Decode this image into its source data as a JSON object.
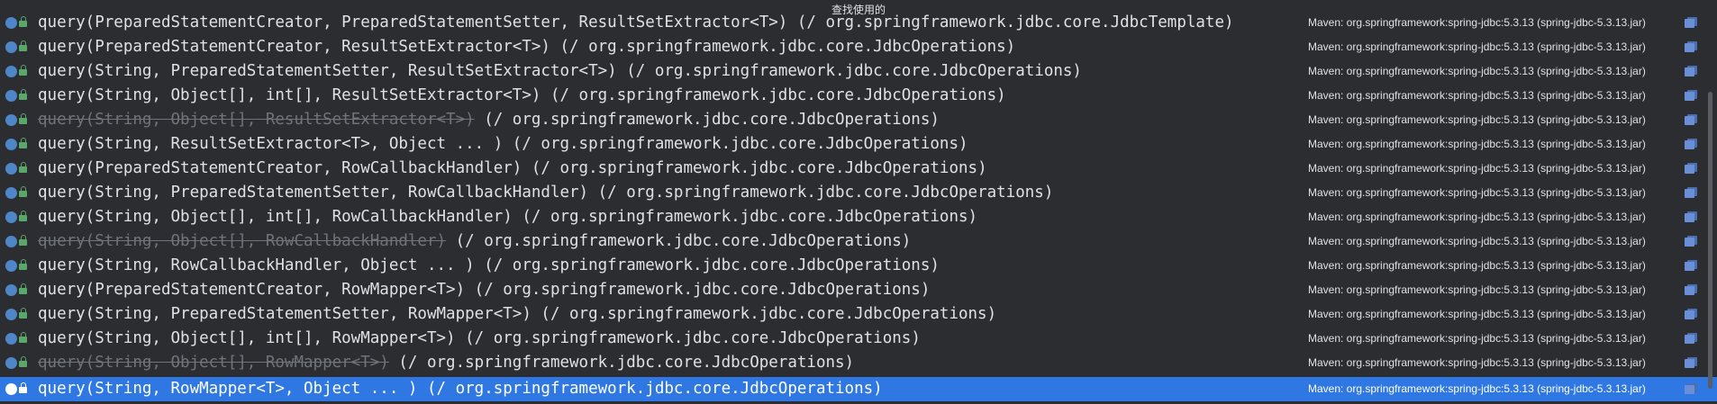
{
  "popup": {
    "title": "查找使用的"
  },
  "results": [
    {
      "parts": [
        {
          "t": "query(PreparedStatementCreator, PreparedStatementSetter, ResultSetExtractor<T>)",
          "d": false
        },
        {
          "t": " (/ org.springframework.jdbc.core.JdbcTemplate)",
          "d": false
        }
      ],
      "location": "Maven: org.springframework:spring-jdbc:5.3.13 (spring-jdbc-5.3.13.jar)",
      "selected": false
    },
    {
      "parts": [
        {
          "t": "query(PreparedStatementCreator, ResultSetExtractor<T>)",
          "d": false
        },
        {
          "t": " (/ org.springframework.jdbc.core.JdbcOperations)",
          "d": false
        }
      ],
      "location": "Maven: org.springframework:spring-jdbc:5.3.13 (spring-jdbc-5.3.13.jar)",
      "selected": false
    },
    {
      "parts": [
        {
          "t": "query(String, PreparedStatementSetter, ResultSetExtractor<T>)",
          "d": false
        },
        {
          "t": " (/ org.springframework.jdbc.core.JdbcOperations)",
          "d": false
        }
      ],
      "location": "Maven: org.springframework:spring-jdbc:5.3.13 (spring-jdbc-5.3.13.jar)",
      "selected": false
    },
    {
      "parts": [
        {
          "t": "query(String, Object[], int[], ResultSetExtractor<T>)",
          "d": false
        },
        {
          "t": " (/ org.springframework.jdbc.core.JdbcOperations)",
          "d": false
        }
      ],
      "location": "Maven: org.springframework:spring-jdbc:5.3.13 (spring-jdbc-5.3.13.jar)",
      "selected": false
    },
    {
      "parts": [
        {
          "t": "query(String, Object[], ResultSetExtractor<T>)",
          "d": true
        },
        {
          "t": " (/ org.springframework.jdbc.core.JdbcOperations)",
          "d": false
        }
      ],
      "location": "Maven: org.springframework:spring-jdbc:5.3.13 (spring-jdbc-5.3.13.jar)",
      "selected": false
    },
    {
      "parts": [
        {
          "t": "query(String, ResultSetExtractor<T>, Object ... )",
          "d": false
        },
        {
          "t": " (/ org.springframework.jdbc.core.JdbcOperations)",
          "d": false
        }
      ],
      "location": "Maven: org.springframework:spring-jdbc:5.3.13 (spring-jdbc-5.3.13.jar)",
      "selected": false
    },
    {
      "parts": [
        {
          "t": "query(PreparedStatementCreator, RowCallbackHandler)",
          "d": false
        },
        {
          "t": " (/ org.springframework.jdbc.core.JdbcOperations)",
          "d": false
        }
      ],
      "location": "Maven: org.springframework:spring-jdbc:5.3.13 (spring-jdbc-5.3.13.jar)",
      "selected": false
    },
    {
      "parts": [
        {
          "t": "query(String, PreparedStatementSetter, RowCallbackHandler)",
          "d": false
        },
        {
          "t": " (/ org.springframework.jdbc.core.JdbcOperations)",
          "d": false
        }
      ],
      "location": "Maven: org.springframework:spring-jdbc:5.3.13 (spring-jdbc-5.3.13.jar)",
      "selected": false
    },
    {
      "parts": [
        {
          "t": "query(String, Object[], int[], RowCallbackHandler)",
          "d": false
        },
        {
          "t": " (/ org.springframework.jdbc.core.JdbcOperations)",
          "d": false
        }
      ],
      "location": "Maven: org.springframework:spring-jdbc:5.3.13 (spring-jdbc-5.3.13.jar)",
      "selected": false
    },
    {
      "parts": [
        {
          "t": "query(String, Object[], RowCallbackHandler)",
          "d": true
        },
        {
          "t": " (/ org.springframework.jdbc.core.JdbcOperations)",
          "d": false
        }
      ],
      "location": "Maven: org.springframework:spring-jdbc:5.3.13 (spring-jdbc-5.3.13.jar)",
      "selected": false
    },
    {
      "parts": [
        {
          "t": "query(String, RowCallbackHandler, Object ... )",
          "d": false
        },
        {
          "t": " (/ org.springframework.jdbc.core.JdbcOperations)",
          "d": false
        }
      ],
      "location": "Maven: org.springframework:spring-jdbc:5.3.13 (spring-jdbc-5.3.13.jar)",
      "selected": false
    },
    {
      "parts": [
        {
          "t": "query(PreparedStatementCreator, RowMapper<T>)",
          "d": false
        },
        {
          "t": " (/ org.springframework.jdbc.core.JdbcOperations)",
          "d": false
        }
      ],
      "location": "Maven: org.springframework:spring-jdbc:5.3.13 (spring-jdbc-5.3.13.jar)",
      "selected": false
    },
    {
      "parts": [
        {
          "t": "query(String, PreparedStatementSetter, RowMapper<T>)",
          "d": false
        },
        {
          "t": " (/ org.springframework.jdbc.core.JdbcOperations)",
          "d": false
        }
      ],
      "location": "Maven: org.springframework:spring-jdbc:5.3.13 (spring-jdbc-5.3.13.jar)",
      "selected": false
    },
    {
      "parts": [
        {
          "t": "query(String, Object[], int[], RowMapper<T>)",
          "d": false
        },
        {
          "t": " (/ org.springframework.jdbc.core.JdbcOperations)",
          "d": false
        }
      ],
      "location": "Maven: org.springframework:spring-jdbc:5.3.13 (spring-jdbc-5.3.13.jar)",
      "selected": false
    },
    {
      "parts": [
        {
          "t": "query(String, Object[], RowMapper<T>)",
          "d": true
        },
        {
          "t": " (/ org.springframework.jdbc.core.JdbcOperations)",
          "d": false
        }
      ],
      "location": "Maven: org.springframework:spring-jdbc:5.3.13 (spring-jdbc-5.3.13.jar)",
      "selected": false
    },
    {
      "parts": [
        {
          "t": "query(String, RowMapper<T>, Object ... )",
          "d": false
        },
        {
          "t": " (/ org.springframework.jdbc.core.JdbcOperations)",
          "d": false
        }
      ],
      "location": "Maven: org.springframework:spring-jdbc:5.3.13 (spring-jdbc-5.3.13.jar)",
      "selected": true
    }
  ],
  "icons": {
    "method": "method-icon",
    "access": "lock-icon",
    "library": "jar-library-icon"
  },
  "colors": {
    "background": "#2b2d30",
    "selection": "#2f78e3",
    "text": "#dfe1e5",
    "deprecated": "#6f737a",
    "method_icon": "#4e86c7",
    "lock_icon": "#59a869"
  }
}
